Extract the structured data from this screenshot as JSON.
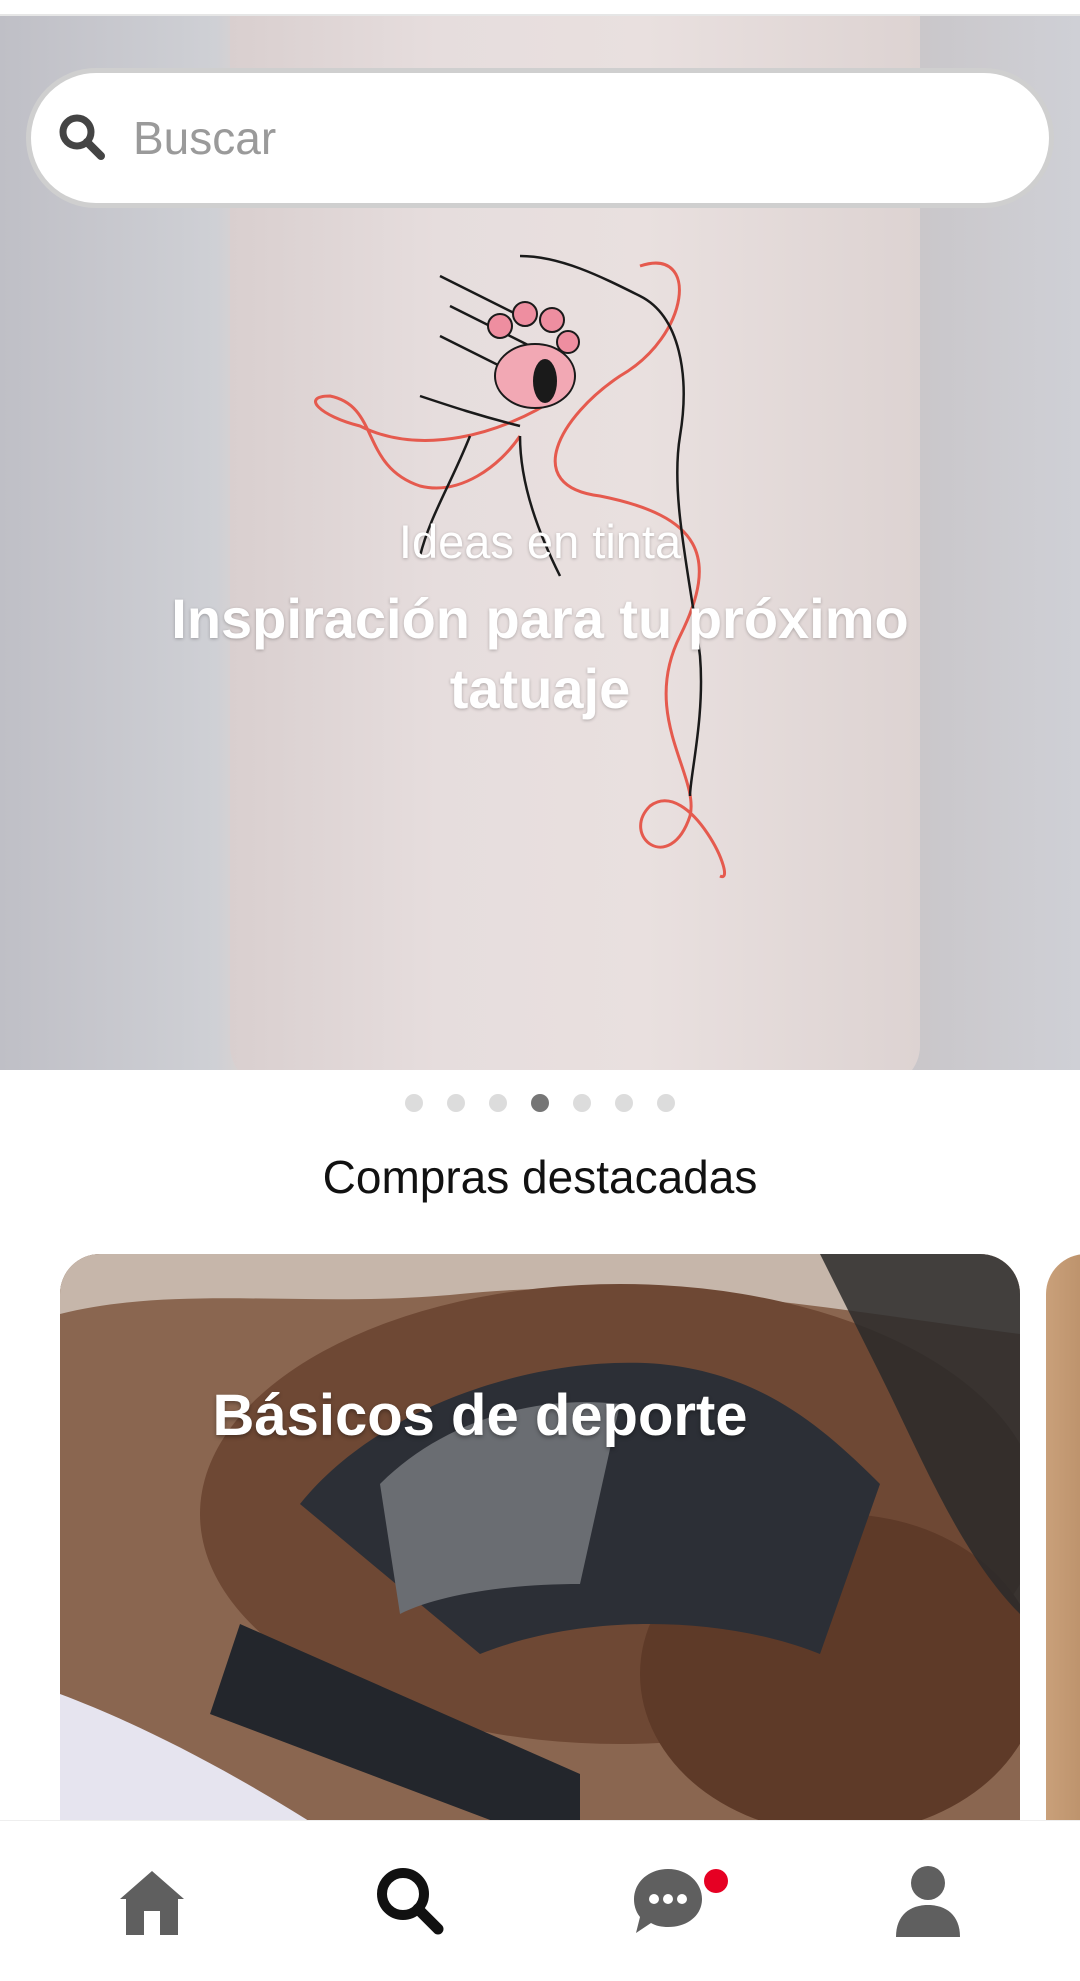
{
  "search": {
    "placeholder": "Buscar"
  },
  "hero": {
    "eyebrow": "Ideas en tinta",
    "title": "Inspiración para tu próximo tatuaje",
    "page_total": 7,
    "page_active": 4
  },
  "featured": {
    "section_title": "Compras destacadas",
    "cards": [
      {
        "title": "Básicos de deporte"
      }
    ]
  },
  "bottom_nav": {
    "items": [
      {
        "name": "home",
        "icon": "home-icon"
      },
      {
        "name": "search",
        "icon": "search-icon",
        "active": true
      },
      {
        "name": "messages",
        "icon": "chat-icon",
        "has_notification": true
      },
      {
        "name": "profile",
        "icon": "profile-icon"
      }
    ]
  },
  "colors": {
    "accent": "#e60023",
    "icon_dark": "#111111",
    "icon_inactive": "#5f5f5f"
  }
}
